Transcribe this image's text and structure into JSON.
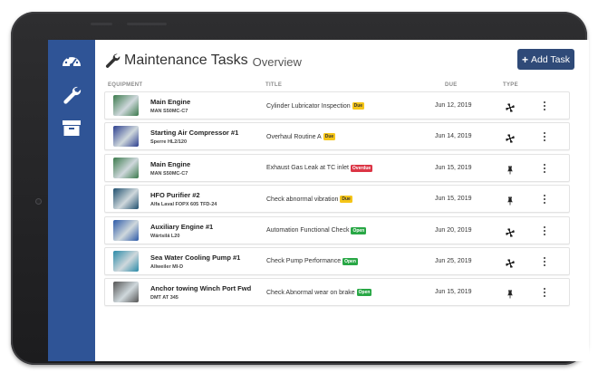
{
  "header": {
    "title": "Maintenance Tasks",
    "subtitle": "Overview",
    "add_button_label": "Add Task"
  },
  "columns": {
    "equipment": "EQUIPMENT",
    "title": "TITLE",
    "due": "DUE",
    "type": "TYPE"
  },
  "sidebar": {
    "items": [
      {
        "icon": "dashboard-gauge-icon"
      },
      {
        "icon": "wrench-icon"
      },
      {
        "icon": "archive-box-icon"
      }
    ]
  },
  "tasks": [
    {
      "equipment": "Main Engine",
      "model": "MAN S50MC-C7",
      "title": "Cylinder Lubricator Inspection",
      "status": "Due",
      "status_kind": "due",
      "due": "Jun 12, 2019",
      "type_icon": "fan-icon",
      "thumb_color": "#3b7a4c"
    },
    {
      "equipment": "Starting Air Compressor #1",
      "model": "Sperre HL2/120",
      "title": "Overhaul Routine A",
      "status": "Due",
      "status_kind": "due",
      "due": "Jun 14, 2019",
      "type_icon": "fan-icon",
      "thumb_color": "#2c3f8f"
    },
    {
      "equipment": "Main Engine",
      "model": "MAN S50MC-C7",
      "title": "Exhaust Gas Leak at TC inlet",
      "status": "Overdue",
      "status_kind": "overdue",
      "due": "Jun 15, 2019",
      "type_icon": "pin-icon",
      "thumb_color": "#3b7a4c"
    },
    {
      "equipment": "HFO Purifier #2",
      "model": "Alfa Laval FOPX 605 TFD-24",
      "title": "Check abnormal vibration",
      "status": "Due",
      "status_kind": "due",
      "due": "Jun 15, 2019",
      "type_icon": "pin-icon",
      "thumb_color": "#1f4f6e"
    },
    {
      "equipment": "Auxiliary Engine #1",
      "model": "Wärtsilä L20",
      "title": "Automation Functional Check",
      "status": "Open",
      "status_kind": "open",
      "due": "Jun 20, 2019",
      "type_icon": "fan-icon",
      "thumb_color": "#2d5aa8"
    },
    {
      "equipment": "Sea Water Cooling Pump #1",
      "model": "Allweiler MI-D",
      "title": "Check Pump Performance",
      "status": "Open",
      "status_kind": "open",
      "due": "Jun 25, 2019",
      "type_icon": "fan-icon",
      "thumb_color": "#2a8aa8"
    },
    {
      "equipment": "Anchor towing Winch Port Fwd",
      "model": "DMT AT 345",
      "title": "Check Abnormal wear on brake",
      "status": "Open",
      "status_kind": "open",
      "due": "Jun 15, 2019",
      "type_icon": "pin-icon",
      "thumb_color": "#555555"
    }
  ],
  "colors": {
    "sidebar": "#2f5496",
    "accent_button": "#2f4a78",
    "due_badge": "#f5c518",
    "overdue_badge": "#dc3545",
    "open_badge": "#28a745"
  }
}
